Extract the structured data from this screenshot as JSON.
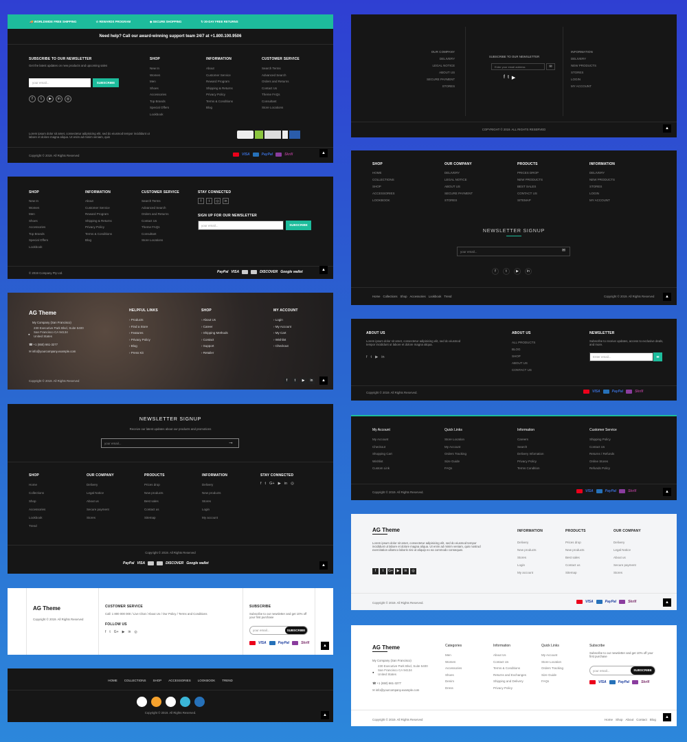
{
  "colors": {
    "teal": "#1dbc9c",
    "dark": "#161616"
  },
  "f1": {
    "features": [
      "WORLDWIDE FREE SHIPPING",
      "REWARDS PROGRAM",
      "SECURE SHOPPING",
      "30-DAY FREE RETURNS"
    ],
    "support": "Need help? Call our award-winning support team 24/7 at +1.800.100.9506",
    "news_title": "SUBSCRIBE TO OUR NEWSLETTER",
    "news_desc": "Get the latest updates on new products and upcoming sales",
    "placeholder": "your email...",
    "subscribe": "SUBSCRIBE",
    "shop_h": "SHOP",
    "shop": [
      "New In",
      "Women",
      "Men",
      "Shoes",
      "Accessories",
      "Top Brands",
      "Special Offers",
      "Lookbook"
    ],
    "info_h": "INFORMATION",
    "info": [
      "About",
      "Customer Service",
      "Reward Program",
      "Shipping & Returns",
      "Privacy Policy",
      "Terms & Conditions",
      "Blog"
    ],
    "cs_h": "CUSTOMER SERVICE",
    "cs": [
      "Search Terms",
      "Advanced Search",
      "Orders and Returns",
      "Contact Us",
      "Theme FAQs",
      "Consultant",
      "Store Locations"
    ],
    "lorem": "Lorem ipsum dolor sit amet, consectetur adipisicing elit, sed do eiusmod tempor incididunt ut labore et dolore magna aliqua. Ut enim ad minim veniam, quis",
    "copy": "Copyright © 2019. All Rights Reserved"
  },
  "f2": {
    "shop_h": "SHOP",
    "shop": [
      "New In",
      "Women",
      "Men",
      "Shoes",
      "Accessories",
      "Top Brands",
      "Special Offers",
      "Lookbook"
    ],
    "info_h": "INFORMATION",
    "info": [
      "About",
      "Customer Service",
      "Reward Program",
      "Shipping & Returns",
      "Privacy Policy",
      "Terms & Conditions",
      "Blog"
    ],
    "cs_h": "CUSTOMER SERVICE",
    "cs": [
      "Search Terms",
      "Advanced Search",
      "Orders and Returns",
      "Contact Us",
      "Theme FAQs",
      "Consultant",
      "Store Locations"
    ],
    "stay": "STAY CONNECTED",
    "signup": "SIGN UP FOR OUR NEWSLETTER",
    "placeholder": "your email...",
    "subscribe": "SUBSCRIBE",
    "copy": "© 2019 Company Pty Ltd."
  },
  "f3": {
    "logo": "AG Theme",
    "company": "My Company (San Francisco)",
    "addr": [
      "230 Executive Park Blvd, Suite 5400",
      "San Francisco CA 94134",
      "United States"
    ],
    "phone": "+1 (650) 661-3277",
    "email": "info@yourcompany.example.com",
    "hl_h": "HELPFUL LINKS",
    "hl": [
      "Products",
      "Find a Store",
      "Features",
      "Privacy Policy",
      "Blog",
      "Press Kit"
    ],
    "shop_h": "SHOP",
    "shop": [
      "About Us",
      "Career",
      "Shipping Methods",
      "Contact",
      "Support",
      "Retailer"
    ],
    "acc_h": "MY ACCOUNT",
    "acc": [
      "Login",
      "My Account",
      "My Cart",
      "Wishlist",
      "Checkout"
    ],
    "copy": "Copyright © 2019. All Rights Reserved"
  },
  "f4": {
    "title": "NEWSLETTER SIGNUP",
    "desc": "Receive our latest updates about our products and promotions",
    "placeholder": "your email...",
    "shop_h": "SHOP",
    "shop": [
      "Home",
      "Collections",
      "Shop",
      "Accessories",
      "Lookbook",
      "Trend"
    ],
    "oc_h": "OUR COMPANY",
    "oc": [
      "Delivery",
      "Legal Notice",
      "About us",
      "Secure payment",
      "Stores"
    ],
    "pr_h": "PRODUCTS",
    "pr": [
      "Prices drop",
      "New products",
      "Best sales",
      "Contact us",
      "Sitemap"
    ],
    "in_h": "INFORMATION",
    "in": [
      "Delivery",
      "New products",
      "Stores",
      "Login",
      "My account"
    ],
    "stay": "STAY CONNECTED",
    "copy": "Copyright © 2019. All Rights Reserved"
  },
  "f5": {
    "logo": "AG Theme",
    "copy": "Copyright © 2019. All Rights Reserved",
    "cs_h": "CUSTOMER SERVICE",
    "cs_line": "Call: 1 800 000 000 / Live Chat / About Us / Our Policy / Terms and Conditions",
    "follow": "FOLLOW US",
    "sub_h": "SUBSCRIBE",
    "sub_desc": "Subscribe to our newsletter and get 10% off your first purchase",
    "placeholder": "your email...",
    "subscribe": "SUBSCRIBE"
  },
  "f6": {
    "nav": [
      "HOME",
      "COLLECTIONS",
      "SHOP",
      "ACCESSORIES",
      "LOOKBOOK",
      "TREND"
    ],
    "copy": "Copyright © 2019. All Rights Reserved."
  },
  "f7": {
    "oc_h": "OUR COMPANY",
    "oc": [
      "DELIVERY",
      "LEGAL NOTICE",
      "ABOUT US",
      "SECURE PAYMENT",
      "STORES"
    ],
    "sub_h": "SUBSCRIBE TO OUR NEWSLETTER",
    "placeholder": "Enter your email address",
    "in_h": "INFORMATION",
    "in": [
      "DELIVERY",
      "NEW PRODUCTS",
      "STORES",
      "LOGIN",
      "MY ACCOUNT"
    ],
    "copy": "COPYRIGHT © 2019. ALL RIGHTS RESERVED"
  },
  "f8": {
    "c1_h": "SHOP",
    "c1": [
      "HOME",
      "COLLECTIONS",
      "SHOP",
      "ACCESSORIES",
      "LOOKBOOK"
    ],
    "c2_h": "OUR COMPANY",
    "c2": [
      "DELIVERY",
      "LEGAL NOTICE",
      "ABOUT US",
      "SECURE PAYMENT",
      "STORES"
    ],
    "c3_h": "PRODUCTS",
    "c3": [
      "PRICES DROP",
      "NEW PRODUCTS",
      "BEST SALES",
      "CONTACT US",
      "SITEMAP"
    ],
    "c4_h": "INFORMATION",
    "c4": [
      "DELIVERY",
      "NEW PRODUCTS",
      "STORES",
      "LOGIN",
      "MY ACCOUNT"
    ],
    "title": "NEWSLETTER SIGNUP",
    "placeholder": "your email...",
    "nav": [
      "Home",
      "Collections",
      "Shop",
      "Accessories",
      "Lookbook",
      "Trend"
    ],
    "copy": "Copyright © 2019. All Rights Reserved"
  },
  "f9": {
    "about_h": "ABOUT US",
    "about": "Lorem ipsum dolor sit amet, consectetur adipisicing elit, sed do eiusmod tempor incididunt ut labore et dolore magna aliqua.",
    "links_h": "ABOUT US",
    "links": [
      "ALL PRODUCTS",
      "BLOG",
      "SHOP",
      "ABOUT US",
      "CONTACT US"
    ],
    "news_h": "NEWSLETTER",
    "news_desc": "Subscribe to receive updates, access to exclusive deals, and more.",
    "placeholder": "Enter email...",
    "copy": "Copyright © 2019. All Rights Reserved."
  },
  "f10": {
    "c1_h": "My Account",
    "c1": [
      "My Account",
      "Checkout",
      "Shopping Cart",
      "Wishlist",
      "Custom Link"
    ],
    "c2_h": "Quick Links",
    "c2": [
      "Store Location",
      "My Account",
      "Orders Tracking",
      "Size Guide",
      "FAQs"
    ],
    "c3_h": "Information",
    "c3": [
      "Careers",
      "Search",
      "Delivery Infomation",
      "Privacy Policy",
      "Terms Condition"
    ],
    "c4_h": "Customer Service",
    "c4": [
      "Shipping Policy",
      "Contact Us",
      "Returns / Refunds",
      "Online Stores",
      "Refunds Policy"
    ],
    "copy": "Copyright © 2019. All Rights Reserved."
  },
  "f11": {
    "logo": "AG Theme",
    "desc": "Lorem ipsum dolor sit amet, consectetur adipisicing elit, sed do eiusmod tempor incididunt ut labore et dolore magna aliqua. Ut enim ad minim veniam, quis nostrud exercitation ullamco laboris nisi ut aliquip ex ea commodo consequat.",
    "in_h": "INFORMATION",
    "in": [
      "Delivery",
      "New products",
      "Stores",
      "Login",
      "My account"
    ],
    "pr_h": "PRODUCTS",
    "pr": [
      "Prices drop",
      "New products",
      "Best sales",
      "Contact us",
      "Sitemap"
    ],
    "oc_h": "OUR COMPANY",
    "oc": [
      "Delivery",
      "Legal Notice",
      "About us",
      "Secure payment",
      "Stores"
    ],
    "copy": "Copyright © 2019. All Rights Reserved."
  },
  "f12": {
    "logo": "AG Theme",
    "company": "My Company (San Francisco)",
    "addr": [
      "230 Executive Park Blvd, Suite 5400",
      "San Francisco CA 94134",
      "United States"
    ],
    "phone": "+1 (650) 661-3277",
    "email": "info@yourcompany.example.com",
    "cat_h": "Categories",
    "cat": [
      "Men",
      "Women",
      "Accessories",
      "Shoes",
      "Denim",
      "Dress"
    ],
    "in_h": "Information",
    "in": [
      "About Us",
      "Contact Us",
      "Terms & Conditions",
      "Returns and Exchanges",
      "Shipping and Delivery",
      "Privacy Policy"
    ],
    "ql_h": "Quick Links",
    "ql": [
      "My Account",
      "Store Location",
      "Orders Tracking",
      "Size Guide",
      "FAQs"
    ],
    "sub_h": "Subscribe",
    "sub_desc": "Subscribe to our newsletter and get 10% off your first purchase",
    "placeholder": "your email...",
    "subscribe": "SUBSCRIBE",
    "copy": "Copyright © 2019. All Rights Reserved",
    "nav": [
      "Home",
      "Shop",
      "About",
      "Contact",
      "Blog"
    ]
  },
  "pay": [
    "PayPal",
    "VISA",
    "DISCOVER",
    "Google wallet",
    "Skrill"
  ]
}
